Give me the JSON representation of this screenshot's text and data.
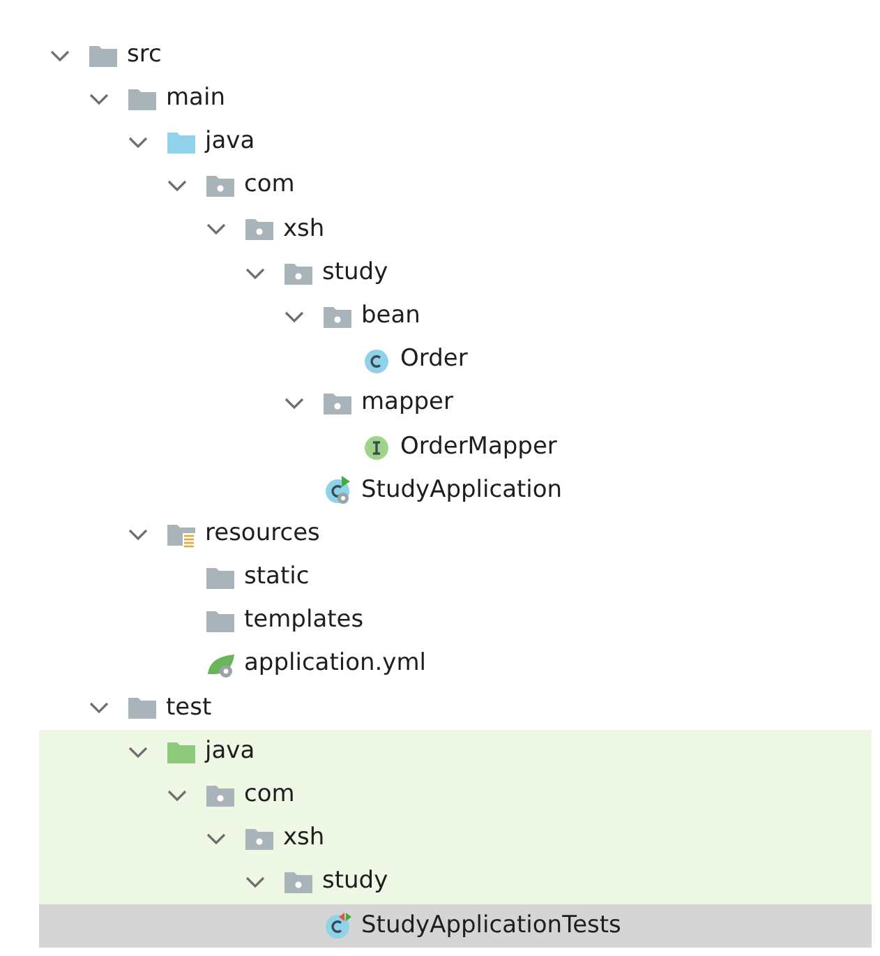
{
  "tree": [
    {
      "label": "src",
      "kind": "folder",
      "expanded": true,
      "selected": false,
      "highlighted": false,
      "children": [
        {
          "label": "main",
          "kind": "folder",
          "expanded": true,
          "selected": false,
          "highlighted": false,
          "children": [
            {
              "label": "java",
              "kind": "source-folder",
              "expanded": true,
              "selected": false,
              "highlighted": false,
              "children": [
                {
                  "label": "com",
                  "kind": "package",
                  "expanded": true,
                  "selected": false,
                  "highlighted": false,
                  "children": [
                    {
                      "label": "xsh",
                      "kind": "package",
                      "expanded": true,
                      "selected": false,
                      "highlighted": false,
                      "children": [
                        {
                          "label": "study",
                          "kind": "package",
                          "expanded": true,
                          "selected": false,
                          "highlighted": false,
                          "children": [
                            {
                              "label": "bean",
                              "kind": "package",
                              "expanded": true,
                              "selected": false,
                              "highlighted": false,
                              "children": [
                                {
                                  "label": "Order",
                                  "kind": "class",
                                  "selected": false,
                                  "highlighted": false
                                }
                              ]
                            },
                            {
                              "label": "mapper",
                              "kind": "package",
                              "expanded": true,
                              "selected": false,
                              "highlighted": false,
                              "children": [
                                {
                                  "label": "OrderMapper",
                                  "kind": "interface",
                                  "selected": false,
                                  "highlighted": false
                                }
                              ]
                            },
                            {
                              "label": "StudyApplication",
                              "kind": "app-class",
                              "selected": false,
                              "highlighted": false
                            }
                          ]
                        }
                      ]
                    }
                  ]
                }
              ]
            },
            {
              "label": "resources",
              "kind": "resources-folder",
              "expanded": true,
              "selected": false,
              "highlighted": false,
              "children": [
                {
                  "label": "static",
                  "kind": "folder",
                  "selected": false,
                  "highlighted": false
                },
                {
                  "label": "templates",
                  "kind": "folder",
                  "selected": false,
                  "highlighted": false
                },
                {
                  "label": "application.yml",
                  "kind": "config-file",
                  "selected": false,
                  "highlighted": false
                }
              ]
            }
          ]
        },
        {
          "label": "test",
          "kind": "folder",
          "expanded": true,
          "selected": false,
          "highlighted": false,
          "children": [
            {
              "label": "java",
              "kind": "test-folder",
              "expanded": true,
              "selected": false,
              "highlighted": true,
              "children": [
                {
                  "label": "com",
                  "kind": "package",
                  "expanded": true,
                  "selected": false,
                  "highlighted": true,
                  "children": [
                    {
                      "label": "xsh",
                      "kind": "package",
                      "expanded": true,
                      "selected": false,
                      "highlighted": true,
                      "children": [
                        {
                          "label": "study",
                          "kind": "package",
                          "expanded": true,
                          "selected": false,
                          "highlighted": true,
                          "children": [
                            {
                              "label": "StudyApplicationTests",
                              "kind": "test-class",
                              "selected": true,
                              "highlighted": false
                            }
                          ]
                        }
                      ]
                    }
                  ]
                }
              ]
            }
          ]
        }
      ]
    }
  ]
}
